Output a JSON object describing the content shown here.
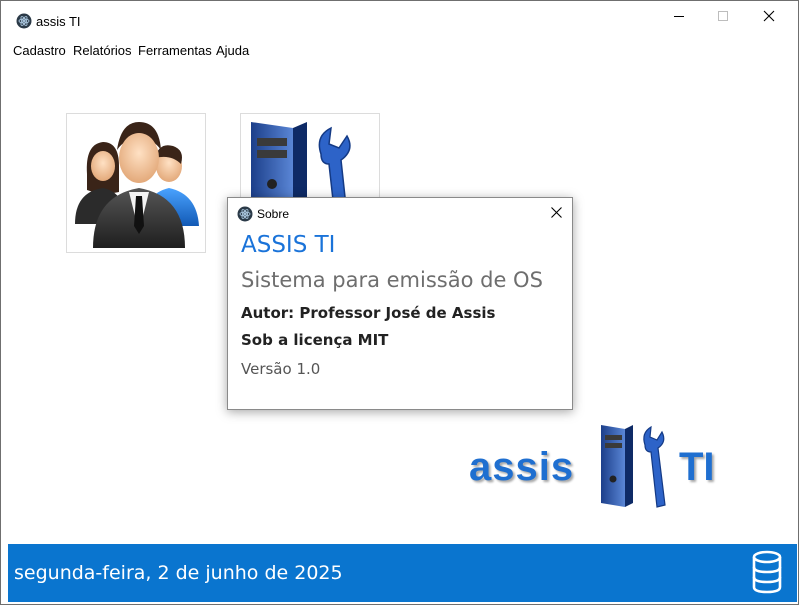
{
  "window": {
    "title": "assis TI",
    "controls": {
      "minimize": "minimize",
      "maximize": "maximize",
      "close": "close"
    }
  },
  "menu": {
    "items": [
      {
        "label": "Cadastro"
      },
      {
        "label": "Relatórios"
      },
      {
        "label": "Ferramentas"
      },
      {
        "label": "Ajuda"
      }
    ]
  },
  "tiles": [
    {
      "icon": "users-icon"
    },
    {
      "icon": "computer-repair-icon"
    }
  ],
  "dialog": {
    "title": "Sobre",
    "app_name": "ASSIS TI",
    "description": "Sistema para emissão de OS",
    "author": "Autor: Professor José de Assis",
    "license": "Sob a licença MIT",
    "version": "Versão 1.0"
  },
  "logo": {
    "left_text": "assis",
    "right_text": "TI"
  },
  "status_bar": {
    "date": "segunda-feira, 2 de junho de 2025",
    "icon": "database-icon",
    "color": "#0a75cf"
  },
  "colors": {
    "accent": "#1a73d9",
    "status_bg": "#0a75cf"
  }
}
